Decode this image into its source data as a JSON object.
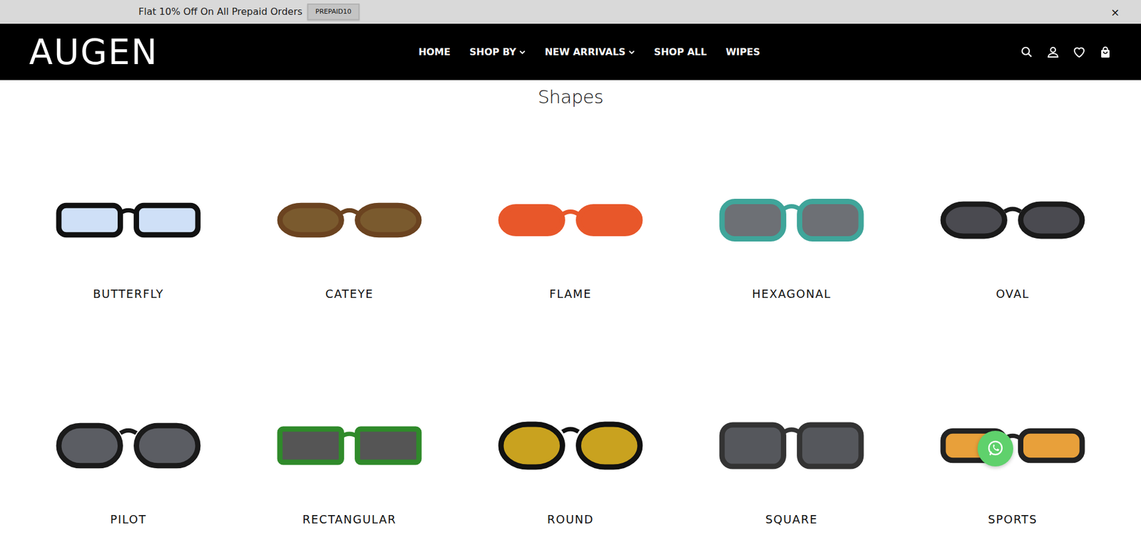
{
  "announcement": {
    "text": "Flat 10% Off On All Prepaid Orders",
    "code": "PREPAID10",
    "close": "×"
  },
  "logo": "AUGEN",
  "nav": [
    {
      "label": "HOME",
      "dropdown": false
    },
    {
      "label": "SHOP BY",
      "dropdown": true
    },
    {
      "label": "NEW ARRIVALS",
      "dropdown": true
    },
    {
      "label": "SHOP ALL",
      "dropdown": false
    },
    {
      "label": "WIPES",
      "dropdown": false
    }
  ],
  "heading": "Shapes",
  "shapes": [
    {
      "label": "BUTTERFLY"
    },
    {
      "label": "CATEYE"
    },
    {
      "label": "FLAME"
    },
    {
      "label": "HEXAGONAL"
    },
    {
      "label": "OVAL"
    },
    {
      "label": "PILOT"
    },
    {
      "label": "RECTANGULAR"
    },
    {
      "label": "ROUND"
    },
    {
      "label": "SQUARE"
    },
    {
      "label": "SPORTS"
    }
  ]
}
